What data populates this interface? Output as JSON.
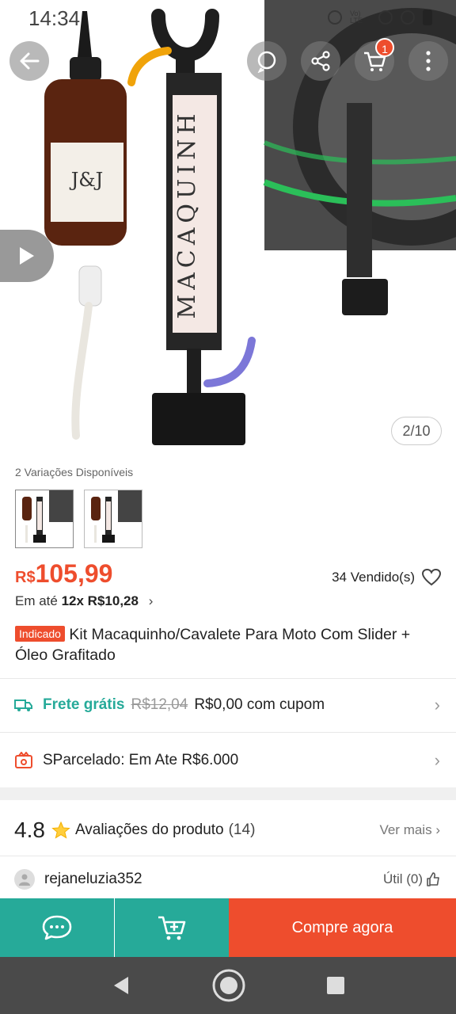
{
  "status_bar": {
    "time": "14:34",
    "network": "Vo) LTE"
  },
  "gallery": {
    "counter": "2/10",
    "cart_badge": "1"
  },
  "product_image": {
    "label_text": "MACAQUINH",
    "bottle_label": "J&J"
  },
  "variations": {
    "title": "2 Variações Disponíveis",
    "count": 2
  },
  "price": {
    "currency": "R$",
    "value": "105,99",
    "sold": "34 Vendido(s)"
  },
  "installments": {
    "prefix": "Em até",
    "value": "12x R$10,28"
  },
  "title": {
    "badge": "Indicado",
    "text": "Kit Macaquinho/Cavalete Para Moto Com Slider + Óleo Grafitado"
  },
  "shipping": {
    "label": "Frete grátis",
    "old_price": "R$12,04",
    "new_price": "R$0,00 com cupom"
  },
  "financing": {
    "text": "SParcelado: Em Ate R$6.000"
  },
  "ratings": {
    "score": "4.8",
    "label": "Avaliações do produto",
    "count": "(14)",
    "see_more": "Ver mais"
  },
  "review": {
    "username": "rejaneluzia352",
    "helpful": "Útil (0)"
  },
  "actions": {
    "buy_now": "Compre agora"
  },
  "colors": {
    "brand": "#ee4d2d",
    "teal": "#26aa99"
  },
  "icons": [
    "back-arrow-icon",
    "whatsapp-icon",
    "share-icon",
    "cart-icon",
    "more-icon",
    "play-icon",
    "heart-icon",
    "truck-icon",
    "parcel-icon",
    "star-icon",
    "user-icon",
    "thumbs-up-icon",
    "chat-icon",
    "add-to-cart-icon",
    "nav-back-icon",
    "nav-home-icon",
    "nav-recents-icon"
  ]
}
